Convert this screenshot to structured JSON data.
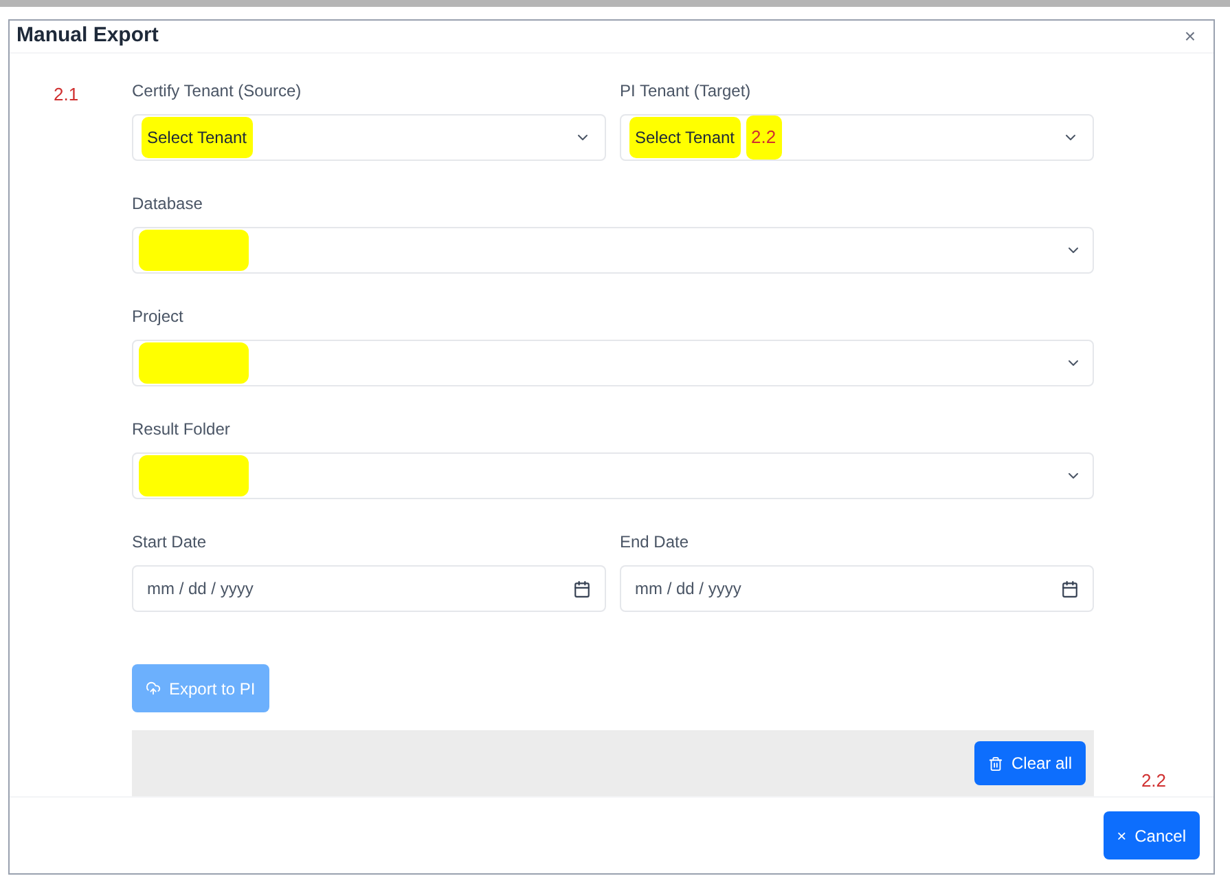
{
  "dialog": {
    "title": "Manual Export",
    "close": "×"
  },
  "annotations": {
    "form": "2.1",
    "target": "2.2",
    "footer": "2.2"
  },
  "tenants": [
    {
      "label": "Certify Tenant (Source)",
      "value": "Select Tenant",
      "highlighted": true
    },
    {
      "label": "PI Tenant (Target)",
      "value": "Select Tenant",
      "highlighted": true
    }
  ],
  "selects": [
    {
      "label": "Database",
      "highlighted": true
    },
    {
      "label": "Project",
      "highlighted": true
    },
    {
      "label": "Result Folder",
      "highlighted": true
    }
  ],
  "dates": [
    {
      "label": "Start Date",
      "placeholder": "mm / dd / yyyy"
    },
    {
      "label": "End Date",
      "placeholder": "mm / dd / yyyy"
    }
  ],
  "export_button": {
    "label": "Export to PI",
    "disabled": true
  },
  "clear_button": {
    "label": "Clear all"
  },
  "cancel_button": {
    "label": "Cancel",
    "icon": "×"
  }
}
